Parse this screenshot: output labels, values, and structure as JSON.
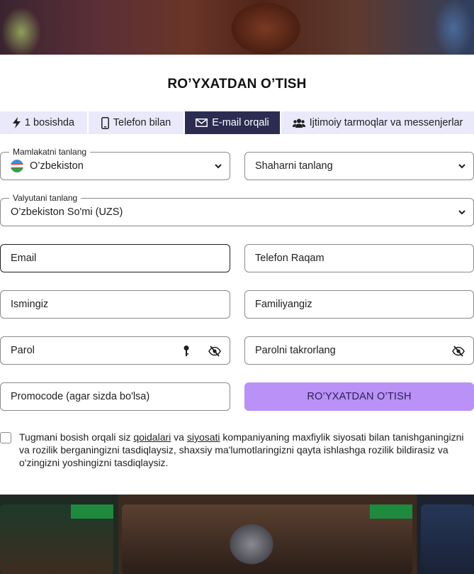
{
  "form": {
    "title": "RO’YXATDAN O’TISH",
    "tabs": [
      {
        "label": "1 bosishda",
        "icon": "lightning-icon",
        "active": false
      },
      {
        "label": "Telefon bilan",
        "icon": "phone-icon",
        "active": false
      },
      {
        "label": "E-mail orqali",
        "icon": "envelope-icon",
        "active": true
      },
      {
        "label": "Ijtimoiy tarmoqlar va messenjerlar",
        "icon": "users-icon",
        "active": false
      }
    ],
    "country": {
      "legend": "Mamlakatni tanlang",
      "value": "O’zbekiston"
    },
    "city": {
      "placeholder": "Shaharni tanlang"
    },
    "currency": {
      "legend": "Valyutani tanlang",
      "value": "O’zbekiston So'mi (UZS)"
    },
    "email": {
      "placeholder": "Email"
    },
    "phone": {
      "placeholder": "Telefon Raqam"
    },
    "first_name": {
      "placeholder": "Ismingiz"
    },
    "last_name": {
      "placeholder": "Familiyangiz"
    },
    "password": {
      "placeholder": "Parol"
    },
    "password_repeat": {
      "placeholder": "Parolni takrorlang"
    },
    "promocode": {
      "placeholder": "Promocode (agar sizda bo'lsa)"
    },
    "submit_label": "RO’YXATDAN O’TISH",
    "consent": {
      "part1": "Tugmani bosish orqali siz ",
      "link1": "qoidalari",
      "part2": " va ",
      "link2": "siyosati",
      "part3": " kompaniyaning maxfiylik siyosati bilan tanishganingizni va rozilik berganingizni tasdiqlaysiz, shaxsiy ma'lumotlaringizni qayta ishlashga rozilik bildirasiz va o'zingizni yoshingizni tasdiqlaysiz."
    }
  },
  "colors": {
    "active_tab": "#2c2c52",
    "tab_bg": "#e9e9fb",
    "submit_bg": "#b991f7"
  }
}
